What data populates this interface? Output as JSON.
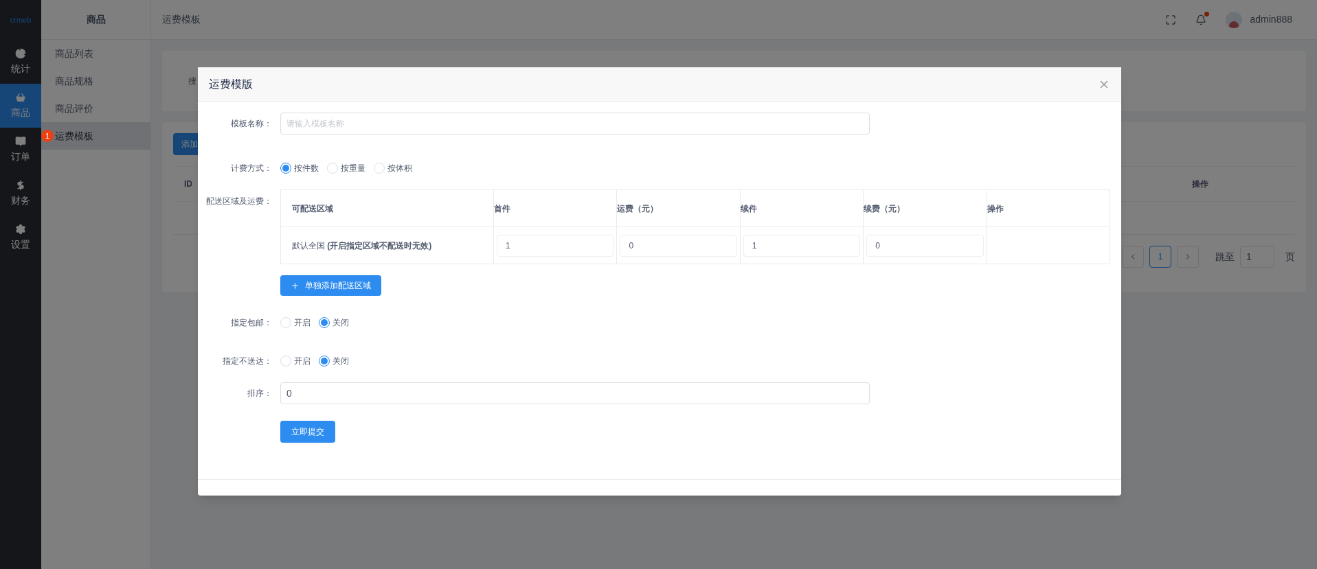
{
  "logo": "crmeb",
  "nav": [
    {
      "label": "统计",
      "selected": false
    },
    {
      "label": "商品",
      "selected": true
    },
    {
      "label": "订单",
      "selected": false
    },
    {
      "label": "财务",
      "selected": false
    },
    {
      "label": "设置",
      "selected": false
    }
  ],
  "submenu": {
    "title": "商品",
    "items": [
      {
        "label": "商品列表",
        "selected": false
      },
      {
        "label": "商品规格",
        "selected": false
      },
      {
        "label": "商品评价",
        "selected": false
      },
      {
        "label": "运费模板",
        "selected": true,
        "badge": "1"
      }
    ]
  },
  "header": {
    "breadcrumb": "运费模板",
    "user": "admin888",
    "notification_dot": true
  },
  "background": {
    "search_label": "搜",
    "add_button": "添加",
    "columns": [
      "ID",
      "操作"
    ],
    "pagination": {
      "pages": [
        {
          "label": "1",
          "selected": true
        }
      ],
      "jump_label": "跳至",
      "jump_value": "1",
      "page_unit": "页"
    }
  },
  "modal": {
    "title": "运费模版",
    "name_label": "模板名称：",
    "name_placeholder": "请输入模板名称",
    "billing_label": "计费方式：",
    "billing_options": [
      {
        "label": "按件数",
        "selected": true
      },
      {
        "label": "按重量",
        "selected": false
      },
      {
        "label": "按体积",
        "selected": false
      }
    ],
    "region_label": "配送区域及运费：",
    "table": {
      "columns": [
        "可配送区域",
        "首件",
        "运费（元）",
        "续件",
        "续费（元）",
        "操作"
      ],
      "rows": [
        {
          "region": "默认全国 **(开启指定区域不配送时无效)**",
          "values": [
            "1",
            "0",
            "1",
            "0"
          ]
        }
      ]
    },
    "add_region_button": "单独添加配送区域",
    "free_shipping_label": "指定包邮：",
    "free_shipping_options": [
      {
        "label": "开启",
        "selected": false
      },
      {
        "label": "关闭",
        "selected": true
      }
    ],
    "no_delivery_label": "指定不送达：",
    "no_delivery_options": [
      {
        "label": "开启",
        "selected": false
      },
      {
        "label": "关闭",
        "selected": true
      }
    ],
    "sort_label": "排序：",
    "sort_value": "0",
    "submit_button": "立即提交"
  }
}
